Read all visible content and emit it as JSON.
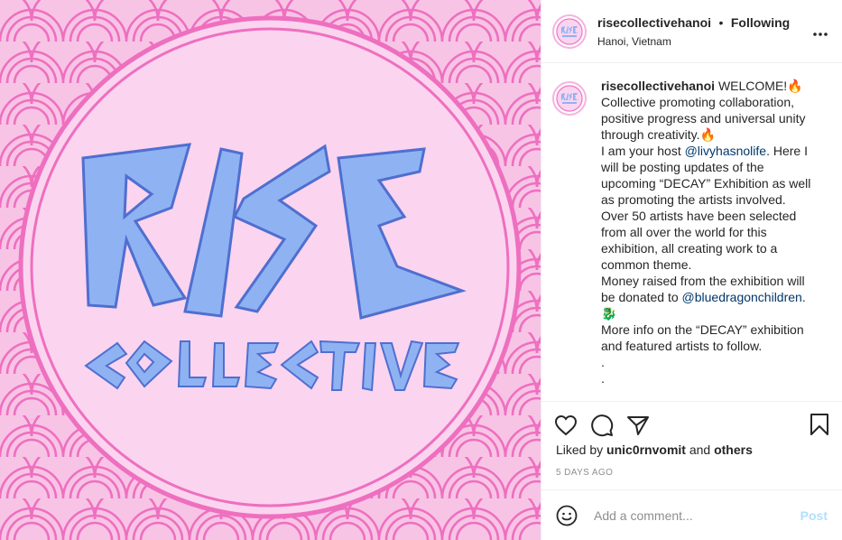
{
  "post": {
    "image_alt_text": "RISE COLLECTIVE",
    "colors": {
      "background_pink": "#f6b3df",
      "circle_fill": "#fbd4ef",
      "lettering_blue": "#8fb3f2",
      "lettering_shadow": "#5e7fd8"
    }
  },
  "header": {
    "username": "risecollectivehanoi",
    "separator": "•",
    "following_label": "Following",
    "location": "Hanoi, Vietnam",
    "more_icon": "more-options-icon"
  },
  "caption": {
    "username": "risecollectivehanoi",
    "lines": [
      "WELCOME!🔥",
      "Collective promoting collaboration,",
      "positive progress and universal unity",
      "through creativity.🔥",
      "I am your host ",
      "@livyhasnolife",
      ". Here I",
      "will be posting updates of the",
      "upcoming “DECAY” Exhibition as well",
      "as promoting the artists involved.",
      "Over 50 artists have been selected",
      "from all over the world for this",
      "exhibition, all creating work to a",
      "common theme.",
      "Money raised from the exhibition will",
      "be donated to ",
      "@bluedragonchildren",
      ".",
      "🐉",
      "More info on the “DECAY” exhibition",
      "and featured artists to follow.",
      ".",
      "."
    ]
  },
  "actions": {
    "icons": [
      "heart-icon",
      "comment-icon",
      "share-icon",
      "bookmark-icon"
    ]
  },
  "likes": {
    "prefix": "Liked by",
    "user": "unic0rnvomit",
    "and": "and",
    "others": "others"
  },
  "timestamp": "5 DAYS AGO",
  "comment_box": {
    "placeholder": "Add a comment...",
    "post_label": "Post",
    "emoji_icon": "emoji-icon"
  }
}
